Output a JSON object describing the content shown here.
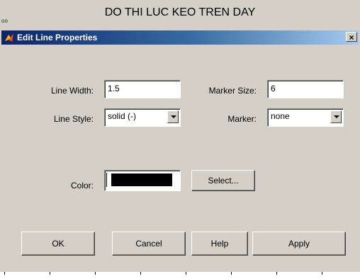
{
  "figure": {
    "title": "DO THI LUC KEO TREN DAY",
    "fragment": "oo"
  },
  "dialog": {
    "title": "Edit Line Properties",
    "close_glyph": "×",
    "line_width_label": "Line Width:",
    "line_width_value": "1.5",
    "marker_size_label": "Marker Size:",
    "marker_size_value": "6",
    "line_style_label": "Line Style:",
    "line_style_value": "solid (-)",
    "marker_label": "Marker:",
    "marker_value": "none",
    "color_label": "Color:",
    "color_value": "#000000",
    "select_label": "Select...",
    "buttons": {
      "ok": "OK",
      "cancel": "Cancel",
      "help": "Help",
      "apply": "Apply"
    }
  },
  "colors": {
    "titlebar_start": "#0a246a",
    "titlebar_end": "#a6caf0",
    "face": "#d4d0c8"
  },
  "icons": {
    "app": "matlab-logo-icon",
    "close": "close-icon",
    "dropdown": "chevron-down-icon"
  }
}
